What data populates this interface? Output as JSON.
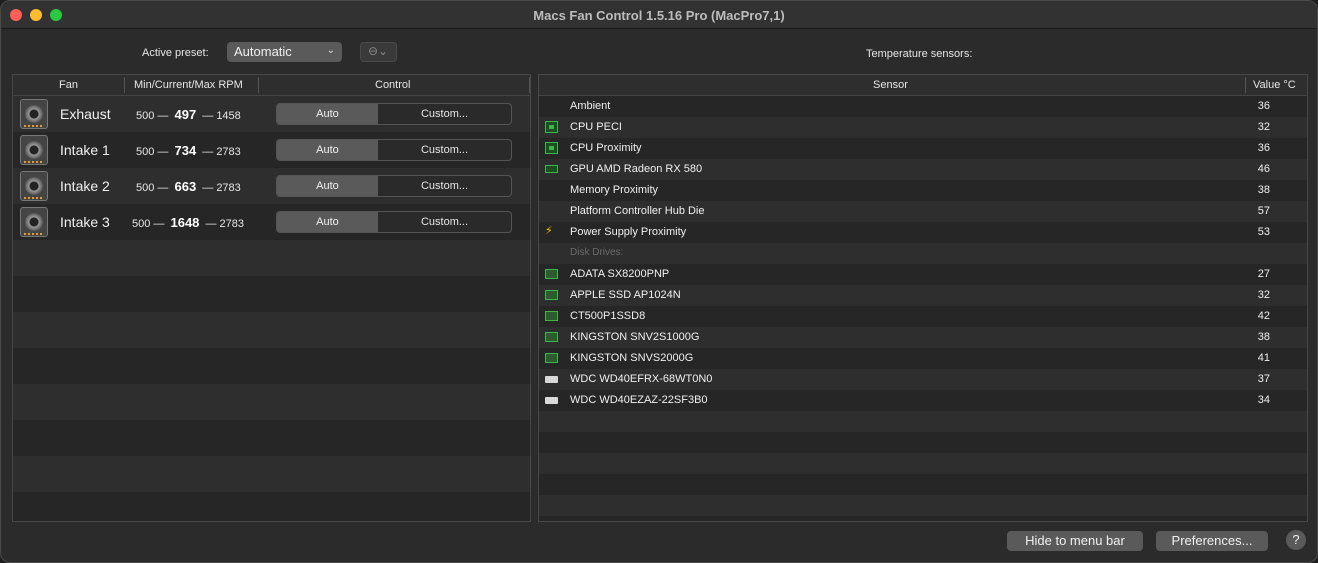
{
  "window": {
    "title": "Macs Fan Control 1.5.16 Pro (MacPro7,1)"
  },
  "preset": {
    "label": "Active preset:",
    "value": "Automatic",
    "more_glyph": "⊖⌄"
  },
  "temperature_label": "Temperature sensors:",
  "fan_table": {
    "headers": {
      "fan": "Fan",
      "rpm": "Min/Current/Max RPM",
      "control": "Control"
    },
    "rows": [
      {
        "name": "Exhaust",
        "min": "500",
        "current": "497",
        "max": "1458",
        "auto": "Auto",
        "custom": "Custom..."
      },
      {
        "name": "Intake 1",
        "min": "500",
        "current": "734",
        "max": "2783",
        "auto": "Auto",
        "custom": "Custom..."
      },
      {
        "name": "Intake 2",
        "min": "500",
        "current": "663",
        "max": "2783",
        "auto": "Auto",
        "custom": "Custom..."
      },
      {
        "name": "Intake 3",
        "min": "500",
        "current": "1648",
        "max": "2783",
        "auto": "Auto",
        "custom": "Custom..."
      }
    ]
  },
  "sensor_table": {
    "headers": {
      "sensor": "Sensor",
      "value": "Value °C"
    },
    "rows": [
      {
        "icon": "none",
        "name": "Ambient",
        "value": "36"
      },
      {
        "icon": "cpu-chip-icon",
        "name": "CPU PECI",
        "value": "32"
      },
      {
        "icon": "cpu-chip-icon",
        "name": "CPU Proximity",
        "value": "36"
      },
      {
        "icon": "gpu-card-icon",
        "name": "GPU AMD Radeon RX 580",
        "value": "46"
      },
      {
        "icon": "none",
        "name": "Memory Proximity",
        "value": "38"
      },
      {
        "icon": "none",
        "name": "Platform Controller Hub Die",
        "value": "57"
      },
      {
        "icon": "lightning-bolt-icon",
        "name": "Power Supply Proximity",
        "value": "53"
      },
      {
        "icon": "group",
        "name": "Disk Drives:",
        "value": ""
      },
      {
        "icon": "ssd-icon",
        "name": "ADATA SX8200PNP",
        "value": "27"
      },
      {
        "icon": "ssd-icon",
        "name": "APPLE SSD AP1024N",
        "value": "32"
      },
      {
        "icon": "ssd-icon",
        "name": "CT500P1SSD8",
        "value": "42"
      },
      {
        "icon": "ssd-icon",
        "name": "KINGSTON SNV2S1000G",
        "value": "38"
      },
      {
        "icon": "ssd-icon",
        "name": "KINGSTON SNVS2000G",
        "value": "41"
      },
      {
        "icon": "hdd-icon",
        "name": "WDC WD40EFRX-68WT0N0",
        "value": "37"
      },
      {
        "icon": "hdd-icon",
        "name": "WDC WD40EZAZ-22SF3B0",
        "value": "34"
      }
    ]
  },
  "footer": {
    "hide_label": "Hide to menu bar",
    "prefs_label": "Preferences...",
    "help_label": "?"
  },
  "colors": {
    "window_bg": "#2b2b2b",
    "control_bg": "#5a5a5a",
    "cpu_icon": "#3fb54a",
    "bolt_icon": "#f5c400"
  }
}
